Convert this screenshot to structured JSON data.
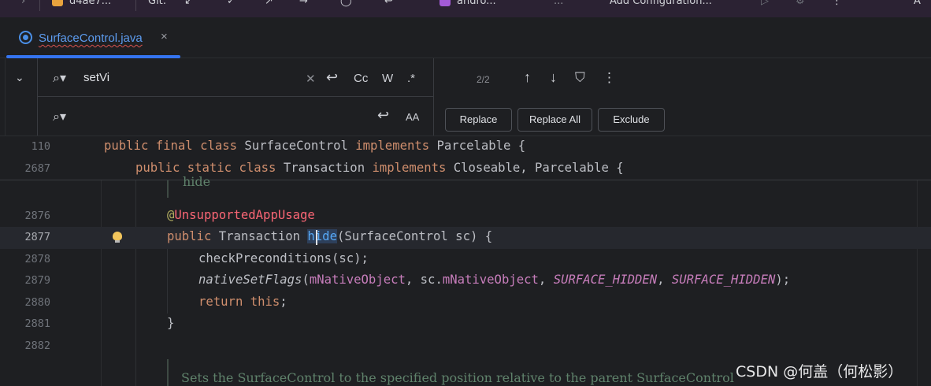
{
  "topbar": {
    "items": [
      "d4ae7...",
      "Git:",
      "andro...",
      "...",
      "Add Configuration..."
    ]
  },
  "tab": {
    "filename": "SurfaceControl.java",
    "close": "×"
  },
  "find": {
    "query": "setVi",
    "replace_value": "",
    "match_case": "Cc",
    "words": "W",
    "regex": ".*",
    "preserve_case": "AA",
    "count": "2/2",
    "replace_label": "Replace",
    "replace_all_label": "Replace All",
    "exclude_label": "Exclude"
  },
  "sticky": [
    {
      "num": "110"
    },
    {
      "num": "2687"
    }
  ],
  "lines": [
    {
      "num": "2876"
    },
    {
      "num": "2877"
    },
    {
      "num": "2878"
    },
    {
      "num": "2879"
    },
    {
      "num": "2880"
    },
    {
      "num": "2881"
    },
    {
      "num": "2882"
    }
  ],
  "code": {
    "s1_public": "public",
    "s1_final": "final",
    "s1_class": "class",
    "s1_name": "SurfaceControl",
    "s1_impl": "implements",
    "s1_parcel": "Parcelable {",
    "s2_public": "public",
    "s2_static": "static",
    "s2_class": "class",
    "s2_name": "Transaction",
    "s2_impl": "implements",
    "s2_rest": "Closeable, Parcelable {",
    "hide_doc": "hide",
    "ann_at": "@",
    "ann_name": "UnsupportedAppUsage",
    "l2_public": "public",
    "l2_type": "Transaction",
    "l2_fn": "hide",
    "l2_rest": "(SurfaceControl sc) {",
    "l3": "checkPreconditions(sc);",
    "l4_fn": "nativeSetFlags",
    "l4_open": "(",
    "l4_f1": "mNativeObject",
    "l4_mid": ", sc.",
    "l4_f2": "mNativeObject",
    "l4_c1": ", ",
    "l4_k1": "SURFACE_HIDDEN",
    "l4_c2": ", ",
    "l4_k2": "SURFACE_HIDDEN",
    "l4_end": ");",
    "l5_return": "return",
    "l5_this": "this",
    "l5_semi": ";",
    "l6": "}",
    "doc_line": "Sets the SurfaceControl to the specified position relative to the parent SurfaceControl"
  },
  "watermark": "CSDN @何盖（何松影）"
}
